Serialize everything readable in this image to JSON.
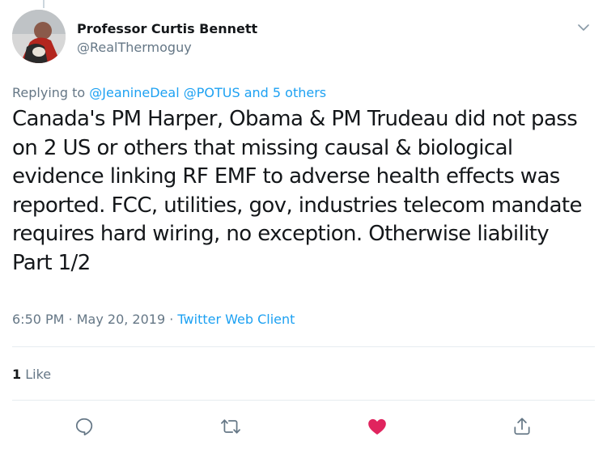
{
  "tweet": {
    "author": {
      "display_name": "Professor Curtis Bennett",
      "handle": "@RealThermoguy"
    },
    "replying_to": {
      "prefix": "Replying to",
      "mentions": "@JeanineDeal @POTUS and 5 others"
    },
    "text": "Canada's PM Harper,  Obama & PM Trudeau did not pass on 2 US or others that missing causal & biological evidence linking RF EMF to adverse health effects was reported. FCC, utilities, gov, industries telecom mandate requires hard wiring, no exception. Otherwise liability Part 1/2",
    "timestamp": "6:50 PM · May 20, 2019 · ",
    "source": "Twitter Web Client",
    "likes_count": "1",
    "likes_label": " Like"
  },
  "icons": {
    "reply": "reply-icon",
    "retweet": "retweet-icon",
    "like": "heart-icon",
    "share": "share-icon",
    "menu": "chevron-down-icon"
  },
  "colors": {
    "accent": "#1da1f2",
    "like_active": "#e0245e",
    "muted": "#657786",
    "text": "#14171a"
  }
}
